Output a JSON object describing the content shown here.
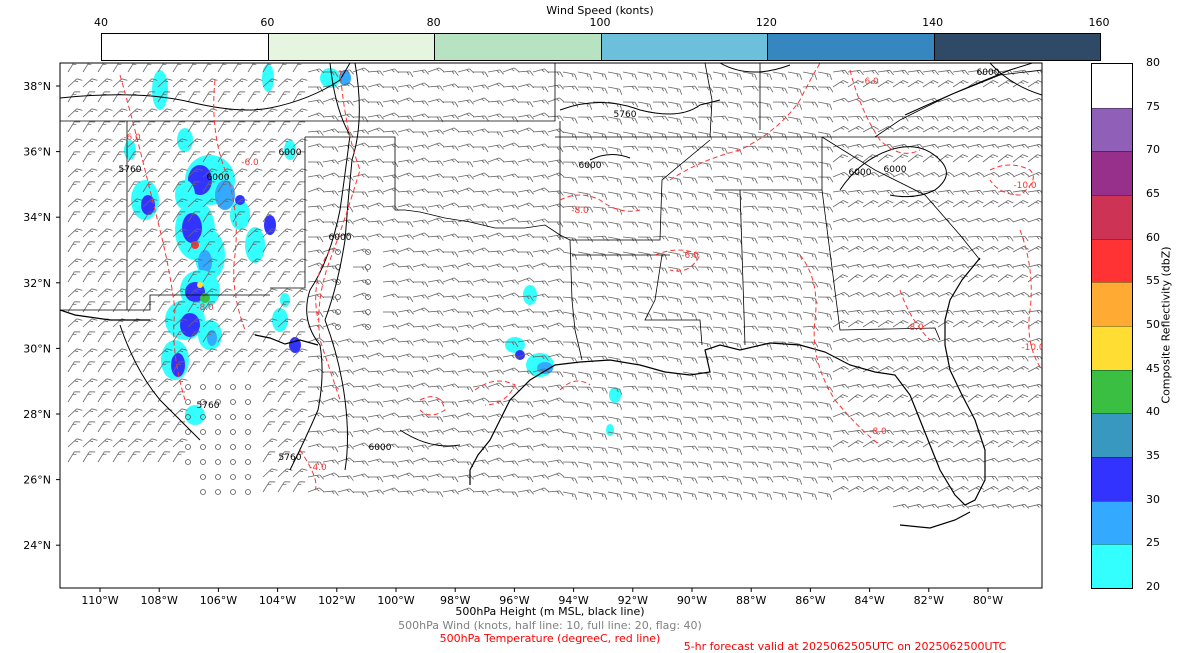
{
  "wind_colorbar": {
    "title": "Wind Speed (konts)",
    "ticks": [
      "40",
      "60",
      "80",
      "100",
      "120",
      "140",
      "160"
    ],
    "colors": [
      "#ffffff",
      "#e5f5e0",
      "#b8e3c3",
      "#6cc0dc",
      "#3686c0",
      "#2e4a66"
    ]
  },
  "refl_colorbar": {
    "label": "Composite Reflectivity (dbZ)",
    "ticks": [
      "20",
      "25",
      "30",
      "35",
      "40",
      "45",
      "50",
      "55",
      "60",
      "65",
      "70",
      "75",
      "80"
    ],
    "colors": [
      "#33ffff",
      "#33aaff",
      "#3333ff",
      "#3898c0",
      "#3abf42",
      "#ffdd33",
      "#ffaa33",
      "#ff3333",
      "#cc3355",
      "#96308a",
      "#9060b8",
      "#ffffff"
    ]
  },
  "map": {
    "lon_labels": [
      "110°W",
      "108°W",
      "106°W",
      "104°W",
      "102°W",
      "100°W",
      "98°W",
      "96°W",
      "94°W",
      "92°W",
      "90°W",
      "88°W",
      "86°W",
      "84°W",
      "82°W",
      "80°W"
    ],
    "lat_labels": [
      "38°N",
      "36°N",
      "34°N",
      "32°N",
      "30°N",
      "28°N",
      "26°N",
      "24°N"
    ],
    "contour_labels": {
      "height": [
        "5760",
        "6000",
        "6000",
        "6000",
        "6000",
        "5760",
        "6000",
        "6000",
        "5760",
        "6000",
        "6000",
        "5760"
      ],
      "temp": [
        "-6.0",
        "-8.0",
        "-6.0",
        "-10.0",
        "-8.0",
        "-6.0",
        "-8.0",
        "-10.0",
        "-4.0",
        "-8.0",
        "-6.0"
      ]
    }
  },
  "captions": {
    "height": "500hPa Height (m MSL, black line)",
    "wind": "500hPa Wind (knots, half line: 10, full line: 20, flag: 40)",
    "temp": "500hPa Temperature (degreeC, red line)",
    "valid": "5-hr forecast valid at 2025062505UTC on 2025062500UTC"
  },
  "caption_colors": {
    "height": "#000000",
    "wind": "#808080",
    "temp": "#ff0000",
    "valid": "#ff0000"
  }
}
